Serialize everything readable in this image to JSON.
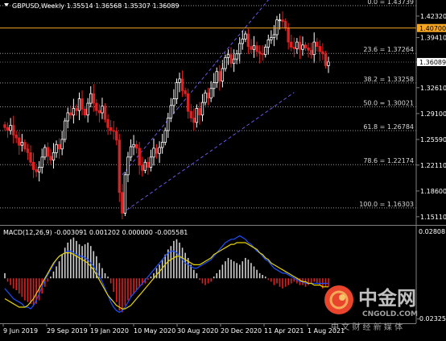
{
  "symbol_header": {
    "text": "GBPUSD,Weekly  1.35514 1.36568 1.35307 1.36089"
  },
  "macd_header": {
    "text": "MACD(12,26,9) -0.003091 0.001202 0.000000 -0.005581"
  },
  "price_axis": {
    "ticks": [
      "1.42320",
      "1.39410",
      "1.36089",
      "1.32610",
      "1.29100",
      "1.25590",
      "1.22110",
      "1.18600",
      "1.15110"
    ],
    "highlight_level": "1.40700",
    "highlight_level_value": 1.407,
    "highlight_color": "#f5a623",
    "current_price": "1.36089",
    "current_price_value": 1.36089,
    "range": [
      1.14,
      1.445
    ]
  },
  "macd_axis": {
    "top": "0.02808",
    "bottom": "-0.02325"
  },
  "fib_levels": [
    {
      "label": "0.0 = 1.43739",
      "value": 1.43739
    },
    {
      "label": "23.6 = 1.37264",
      "value": 1.37264
    },
    {
      "label": "38.2 = 1.33258",
      "value": 1.33258
    },
    {
      "label": "50.0 = 1.30021",
      "value": 1.30021
    },
    {
      "label": "61.8 = 1.26784",
      "value": 1.26784
    },
    {
      "label": "78.6 = 1.22174",
      "value": 1.22174
    },
    {
      "label": "100.0 = 1.16303",
      "value": 1.16303
    }
  ],
  "time_axis": {
    "labels": [
      "9 Jun 2019",
      "29 Sep 2019",
      "19 Jan 2020",
      "10 May 2020",
      "30 Aug 2020",
      "20 Dec 2020",
      "11 Apr 2021",
      "1 Aug 2021"
    ]
  },
  "candles": {
    "closes": [
      1.272,
      1.268,
      1.275,
      1.262,
      1.258,
      1.248,
      1.252,
      1.243,
      1.238,
      1.225,
      1.215,
      1.212,
      1.218,
      1.232,
      1.245,
      1.233,
      1.228,
      1.238,
      1.249,
      1.243,
      1.256,
      1.281,
      1.292,
      1.289,
      1.298,
      1.295,
      1.311,
      1.297,
      1.289,
      1.305,
      1.318,
      1.305,
      1.295,
      1.292,
      1.301,
      1.283,
      1.272,
      1.268,
      1.267,
      1.255,
      1.184,
      1.156,
      1.208,
      1.232,
      1.246,
      1.249,
      1.244,
      1.221,
      1.214,
      1.225,
      1.218,
      1.232,
      1.244,
      1.237,
      1.245,
      1.252,
      1.268,
      1.285,
      1.302,
      1.311,
      1.333,
      1.338,
      1.322,
      1.318,
      1.294,
      1.285,
      1.279,
      1.298,
      1.289,
      1.306,
      1.319,
      1.312,
      1.325,
      1.333,
      1.348,
      1.335,
      1.352,
      1.367,
      1.371,
      1.359,
      1.365,
      1.372,
      1.386,
      1.392,
      1.399,
      1.382,
      1.378,
      1.383,
      1.375,
      1.372,
      1.371,
      1.381,
      1.391,
      1.394,
      1.398,
      1.418,
      1.418,
      1.416,
      1.407,
      1.388,
      1.381,
      1.379,
      1.388,
      1.378,
      1.384,
      1.38,
      1.377,
      1.371,
      1.388,
      1.382,
      1.375,
      1.372,
      1.356,
      1.361
    ],
    "up_color": "#ffffff",
    "down_color": "#e02020"
  },
  "macd": {
    "hist": [
      0.003,
      -0.002,
      -0.004,
      -0.006,
      -0.007,
      -0.009,
      -0.011,
      -0.013,
      -0.014,
      -0.015,
      -0.016,
      -0.015,
      -0.013,
      -0.009,
      -0.005,
      -0.002,
      0.001,
      0.004,
      0.007,
      0.01,
      0.014,
      0.018,
      0.021,
      0.023,
      0.024,
      0.022,
      0.02,
      0.019,
      0.02,
      0.021,
      0.019,
      0.016,
      0.013,
      0.009,
      0.006,
      0.003,
      0.001,
      -0.003,
      -0.008,
      -0.014,
      -0.019,
      -0.02,
      -0.016,
      -0.013,
      -0.011,
      -0.009,
      -0.007,
      -0.005,
      -0.004,
      -0.003,
      -0.001,
      0.001,
      0.003,
      0.006,
      0.008,
      0.011,
      0.014,
      0.017,
      0.019,
      0.022,
      0.023,
      0.021,
      0.018,
      0.015,
      0.012,
      0.008,
      0.005,
      0.003,
      -0.001,
      -0.003,
      -0.004,
      -0.003,
      -0.002,
      0.001,
      0.003,
      0.005,
      0.008,
      0.01,
      0.012,
      0.011,
      0.01,
      0.009,
      0.008,
      0.01,
      0.012,
      0.011,
      0.009,
      0.007,
      0.005,
      0.003,
      0.002,
      0.001,
      -0.001,
      -0.002,
      -0.004,
      -0.003,
      -0.005,
      -0.006,
      -0.005,
      -0.004,
      -0.003,
      -0.002,
      -0.003,
      -0.004,
      -0.004,
      -0.005,
      -0.004,
      -0.003,
      -0.002,
      -0.003,
      -0.004,
      -0.006,
      -0.005,
      -0.005
    ],
    "main": [
      -0.006,
      -0.008,
      -0.01,
      -0.012,
      -0.013,
      -0.014,
      -0.015,
      -0.017,
      -0.017,
      -0.018,
      -0.016,
      -0.013,
      -0.009,
      -0.005,
      -0.001,
      0.002,
      0.005,
      0.008,
      0.011,
      0.013,
      0.014,
      0.015,
      0.016,
      0.016,
      0.015,
      0.014,
      0.013,
      0.013,
      0.012,
      0.011,
      0.009,
      0.007,
      0.004,
      0.001,
      -0.002,
      -0.006,
      -0.01,
      -0.014,
      -0.017,
      -0.019,
      -0.02,
      -0.019,
      -0.017,
      -0.014,
      -0.011,
      -0.009,
      -0.007,
      -0.005,
      -0.003,
      -0.001,
      0.001,
      0.003,
      0.005,
      0.007,
      0.009,
      0.011,
      0.013,
      0.015,
      0.016,
      0.016,
      0.015,
      0.013,
      0.011,
      0.009,
      0.008,
      0.007,
      0.006,
      0.006,
      0.007,
      0.008,
      0.009,
      0.01,
      0.011,
      0.013,
      0.015,
      0.017,
      0.019,
      0.021,
      0.022,
      0.023,
      0.023,
      0.024,
      0.025,
      0.024,
      0.023,
      0.021,
      0.02,
      0.018,
      0.016,
      0.015,
      0.013,
      0.011,
      0.01,
      0.008,
      0.006,
      0.005,
      0.004,
      0.003,
      0.003,
      0.002,
      0.001,
      0.0,
      -0.001,
      -0.002,
      -0.002,
      -0.003,
      -0.003,
      -0.003,
      -0.003,
      -0.003,
      -0.003,
      -0.003,
      -0.003,
      -0.003
    ],
    "signal": [
      -0.012,
      -0.013,
      -0.014,
      -0.015,
      -0.016,
      -0.017,
      -0.017,
      -0.017,
      -0.016,
      -0.014,
      -0.012,
      -0.009,
      -0.006,
      -0.003,
      0.0,
      0.003,
      0.006,
      0.009,
      0.011,
      0.013,
      0.014,
      0.015,
      0.015,
      0.015,
      0.014,
      0.013,
      0.012,
      0.011,
      0.01,
      0.009,
      0.007,
      0.005,
      0.002,
      -0.001,
      -0.004,
      -0.007,
      -0.01,
      -0.012,
      -0.014,
      -0.016,
      -0.017,
      -0.018,
      -0.018,
      -0.017,
      -0.016,
      -0.014,
      -0.012,
      -0.01,
      -0.008,
      -0.006,
      -0.004,
      -0.002,
      0.0,
      0.002,
      0.004,
      0.006,
      0.008,
      0.01,
      0.011,
      0.012,
      0.013,
      0.013,
      0.012,
      0.011,
      0.01,
      0.009,
      0.008,
      0.008,
      0.008,
      0.009,
      0.01,
      0.011,
      0.012,
      0.014,
      0.015,
      0.016,
      0.017,
      0.018,
      0.019,
      0.02,
      0.02,
      0.021,
      0.021,
      0.021,
      0.021,
      0.02,
      0.019,
      0.018,
      0.017,
      0.015,
      0.014,
      0.012,
      0.011,
      0.009,
      0.008,
      0.007,
      0.006,
      0.005,
      0.004,
      0.003,
      0.002,
      0.001,
      0.0,
      -0.001,
      -0.002,
      -0.002,
      -0.003,
      -0.003,
      -0.004,
      -0.004,
      -0.004,
      -0.005,
      -0.005,
      -0.005
    ],
    "range": [
      -0.026,
      0.03
    ],
    "main_color": "#1e50ff",
    "signal_color": "#e6d200",
    "hist_pos_color": "#d0d0d0",
    "hist_neg_color": "#e02020"
  },
  "watermark": {
    "brand_cn": "中金网",
    "domain": "CNGOLD.COM",
    "slogan_cn": "中 文 财 经 新 媒 体"
  }
}
